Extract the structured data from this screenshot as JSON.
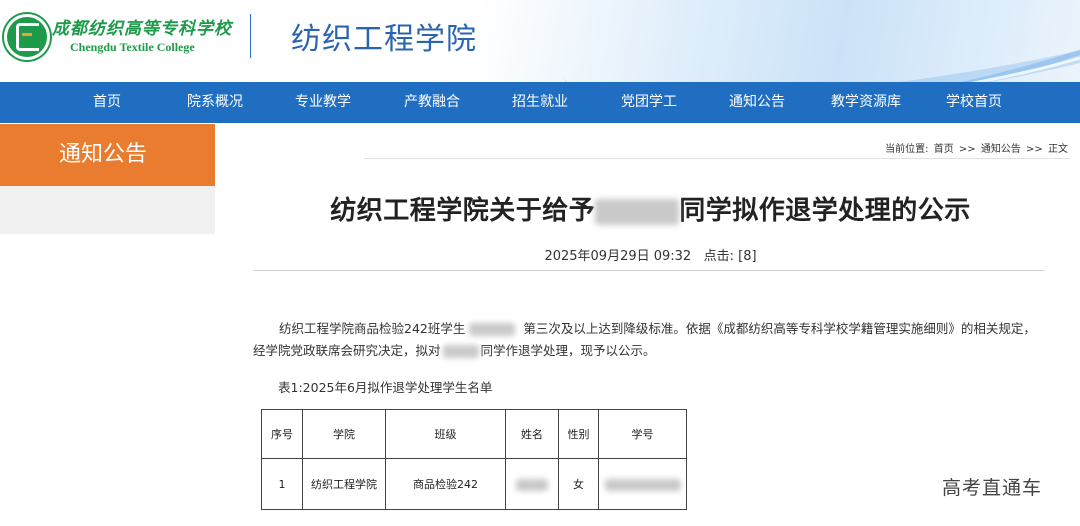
{
  "header": {
    "school_name_cn": "成都纺织高等专科学校",
    "school_name_en": "Chengdu Textile College",
    "site_title": "纺织工程学院",
    "brand_color": "#1e9b4a",
    "title_color": "#2a64b0"
  },
  "nav": {
    "color": "#1f6ec1",
    "items": [
      {
        "label": "首页"
      },
      {
        "label": "院系概况"
      },
      {
        "label": "专业教学"
      },
      {
        "label": "产教融合"
      },
      {
        "label": "招生就业"
      },
      {
        "label": "党团学工"
      },
      {
        "label": "通知公告"
      },
      {
        "label": "教学资源库"
      },
      {
        "label": "学校首页"
      }
    ]
  },
  "sidebar": {
    "heading": "通知公告",
    "heading_color": "#ea7c30"
  },
  "breadcrumb": {
    "prefix": "当前位置:",
    "items": [
      "首页",
      "通知公告",
      "正文"
    ],
    "separator": ">>"
  },
  "article": {
    "title_before": "纺织工程学院关于给予",
    "title_after": "同学拟作退学处理的公示",
    "datetime": "2025年09月29日 09:32",
    "clicks_label": "点击:",
    "clicks_value": "[8]",
    "para_part1": "纺织工程学院商品检验242班学生",
    "para_part2": "第三次及以上达到降级标准。依据《成都纺织高等专科学校学籍管理实施细则》的相关规定，经学院党政联席会研究决定，拟对",
    "para_part3": "同学作退学处理，现予以公示。",
    "table_caption": "表1:2025年6月拟作退学处理学生名单"
  },
  "table": {
    "headers": [
      "序号",
      "学院",
      "班级",
      "姓名",
      "性别",
      "学号"
    ],
    "rows": [
      [
        "1",
        "纺织工程学院",
        "商品检验242",
        "",
        "女",
        ""
      ]
    ]
  },
  "watermark": "高考直通车"
}
